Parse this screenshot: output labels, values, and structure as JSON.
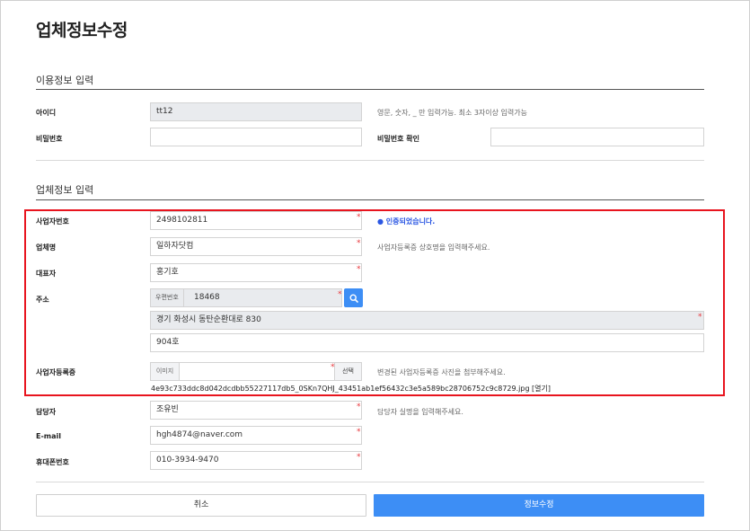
{
  "page": {
    "title": "업체정보수정"
  },
  "usage_section": {
    "title": "이용정보 입력",
    "id_label": "아이디",
    "id_value": "tt12",
    "id_hint": "영문, 숫자, _ 만 입력가능. 최소 3자이상 입력가능",
    "password_label": "비밀번호",
    "password_value": "",
    "password_confirm_label": "비밀번호 확인",
    "password_confirm_value": ""
  },
  "company_section": {
    "title": "업체정보 입력",
    "business_number_label": "사업자번호",
    "business_number_value": "2498102811",
    "business_number_status": "● 인증되었습니다.",
    "company_name_label": "업체명",
    "company_name_value": "일하자닷컴",
    "company_name_hint": "사업자등록증 상호명을 입력해주세요.",
    "ceo_label": "대표자",
    "ceo_value": "홍기호",
    "address_label": "주소",
    "zip_label": "우편번호",
    "zip_value": "18468",
    "address_value": "경기 화성시 동탄순환대로 830",
    "address_detail_value": "904호",
    "registration_label": "사업자등록증",
    "file_prefix": "이미지",
    "file_select": "선택",
    "registration_hint": "변경된 사업자등록증 사진을 첨부해주세요.",
    "registration_filename": "4e93c733ddc8d042dcdbb55227117db5_0SKn7QHJ_43451ab1ef56432c3e5a589bc28706752c9c8729.jpg [열기]",
    "manager_label": "담당자",
    "manager_value": "조유빈",
    "manager_hint": "담당자 실명을 입력해주세요.",
    "email_label": "E-mail",
    "email_value": "hgh4874@naver.com",
    "phone_label": "휴대폰번호",
    "phone_value": "010-3934-9470"
  },
  "required_mark": "*",
  "buttons": {
    "cancel": "취소",
    "submit": "정보수정"
  },
  "colors": {
    "accent": "#3d8ef5",
    "highlight": "#e8141e",
    "required": "#e8383d",
    "verified": "#2b57e3"
  },
  "icons": {
    "search": "search-icon"
  }
}
